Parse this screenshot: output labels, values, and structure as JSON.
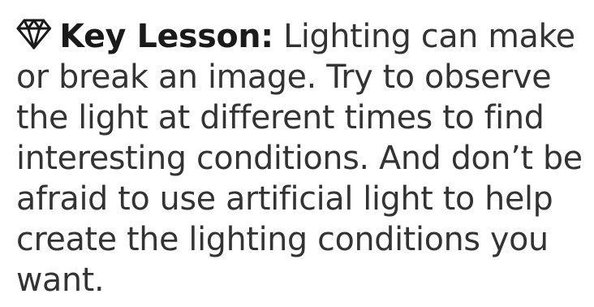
{
  "callout": {
    "icon": "diamond-icon",
    "label": "Key Lesson:",
    "lines": [
      "Lighting can make",
      "or break an image. Try to observe",
      "the light at different times to find",
      "interesting conditions. And don’t be",
      "afraid to use artificial light to help",
      "create the lighting conditions you",
      "want."
    ]
  },
  "colors": {
    "text": "#333333",
    "label": "#1a1a1a",
    "background": "#ffffff"
  }
}
